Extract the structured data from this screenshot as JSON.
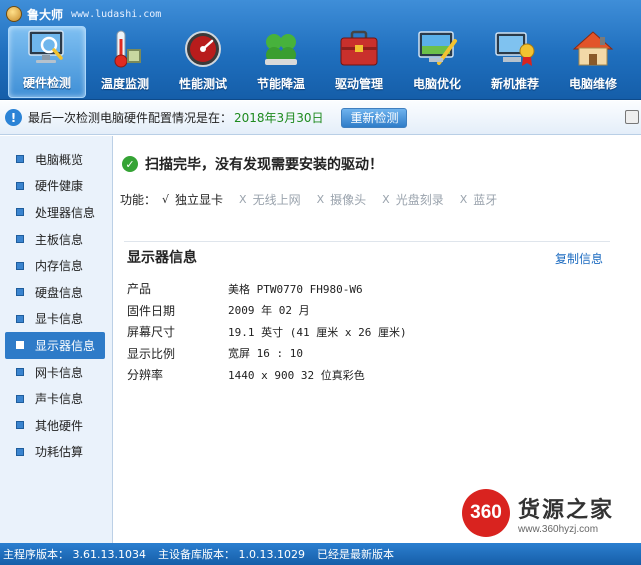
{
  "app": {
    "name": "鲁大师",
    "url": "www.ludashi.com"
  },
  "toolbar": [
    {
      "label": "硬件检测",
      "icon": "monitor-magnifier-icon",
      "active": true
    },
    {
      "label": "温度监测",
      "icon": "thermometer-icon",
      "active": false
    },
    {
      "label": "性能测试",
      "icon": "speedometer-icon",
      "active": false
    },
    {
      "label": "节能降温",
      "icon": "clover-icon",
      "active": false
    },
    {
      "label": "驱动管理",
      "icon": "toolbox-icon",
      "active": false
    },
    {
      "label": "电脑优化",
      "icon": "screen-brush-icon",
      "active": false
    },
    {
      "label": "新机推荐",
      "icon": "computer-award-icon",
      "active": false
    },
    {
      "label": "电脑维修",
      "icon": "house-icon",
      "active": false
    }
  ],
  "notice": {
    "text": "最后一次检测电脑硬件配置情况是在：",
    "date": "2018年3月30日",
    "recheck_label": "重新检测"
  },
  "sidebar": {
    "items": [
      {
        "label": "电脑概览"
      },
      {
        "label": "硬件健康"
      },
      {
        "label": "处理器信息"
      },
      {
        "label": "主板信息"
      },
      {
        "label": "内存信息"
      },
      {
        "label": "硬盘信息"
      },
      {
        "label": "显卡信息"
      },
      {
        "label": "显示器信息",
        "active": true
      },
      {
        "label": "网卡信息"
      },
      {
        "label": "声卡信息"
      },
      {
        "label": "其他硬件"
      },
      {
        "label": "功耗估算"
      }
    ]
  },
  "main": {
    "status": "扫描完毕，没有发现需要安装的驱动！",
    "func_label": "功能：",
    "functions": [
      {
        "mark": "√",
        "name": "独立显卡",
        "on": true
      },
      {
        "mark": "X",
        "name": "无线上网",
        "on": false
      },
      {
        "mark": "X",
        "name": "摄像头",
        "on": false
      },
      {
        "mark": "X",
        "name": "光盘刻录",
        "on": false
      },
      {
        "mark": "X",
        "name": "蓝牙",
        "on": false
      }
    ],
    "section_title": "显示器信息",
    "copy_label": "复制信息",
    "info": [
      {
        "key": "产品",
        "value": "美格 PTW0770 FH980-W6"
      },
      {
        "key": "固件日期",
        "value": "2009 年 02 月"
      },
      {
        "key": "屏幕尺寸",
        "value": "19.1 英寸 (41 厘米 x 26 厘米)"
      },
      {
        "key": "显示比例",
        "value": "宽屏 16 : 10"
      },
      {
        "key": "分辨率",
        "value": "1440 x 900 32 位真彩色"
      }
    ]
  },
  "statusbar": {
    "main_version": "主程序版本： 3.61.13.1034",
    "db_version": "主设备库版本： 1.0.13.1029",
    "update_status": "已经是最新版本"
  },
  "watermark": {
    "badge": "360",
    "brand": "货源之家",
    "url": "www.360hyzj.com"
  }
}
